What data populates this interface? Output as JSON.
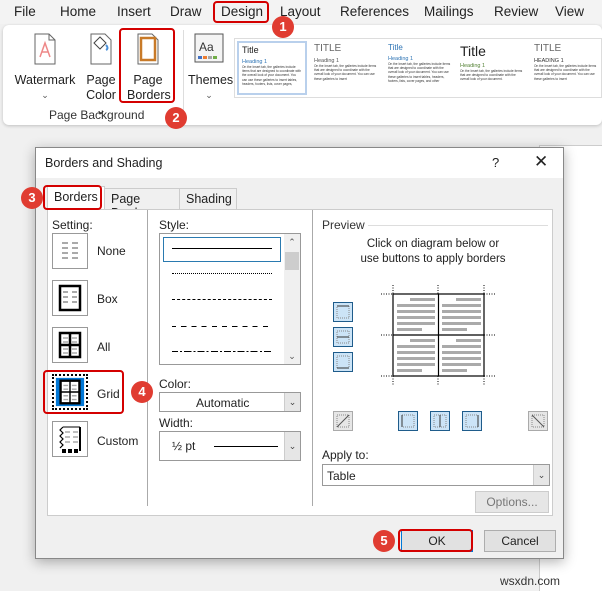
{
  "menu": [
    "File",
    "Home",
    "Insert",
    "Draw",
    "Design",
    "Layout",
    "References",
    "Mailings",
    "Review",
    "View"
  ],
  "ribbon": {
    "watermark": {
      "label1": "Watermark",
      "chev": "⌄"
    },
    "page_color": {
      "label1": "Page",
      "label2": "Color ⌄"
    },
    "page_borders": {
      "label1": "Page",
      "label2": "Borders"
    },
    "themes": {
      "label1": "Themes",
      "chev": "⌄"
    },
    "group_name": "Page Background",
    "gallery": [
      {
        "title": "Title",
        "heading": "Heading 1",
        "body": "On the Insert tab, the galleries include items that are designed to coordinate with the overall look of your document. You can use these galleries to insert tables, headers, footers, lists, cover pages,"
      },
      {
        "title": "TITLE",
        "heading": "Heading 1",
        "body": "On the Insert tab, the galleries include items that are designed to coordinate with the overall look of your document. You can use these galleries to insert"
      },
      {
        "title": "Title",
        "heading": "Heading 1",
        "body": "On the Insert tab, the galleries include items that are designed to coordinate with the overall look of your document. You can use these galleries to insert tables, headers, footers, lists, cover pages, and other"
      },
      {
        "title": "Title",
        "heading": "Heading 1",
        "body": "On the Insert tab, the galleries include items that are designed to coordinate with the overall look of your document."
      },
      {
        "title": "TITLE",
        "heading": "HEADING 1",
        "body": "On the Insert tab, the galleries include items that are designed to coordinate with the overall look of your document. You can use these galleries to insert"
      }
    ]
  },
  "badges": [
    "1",
    "2",
    "3",
    "4",
    "5"
  ],
  "dialog": {
    "title": "Borders and Shading",
    "help": "?",
    "close": "✕",
    "tabs": [
      "Borders",
      "Page Border",
      "Shading"
    ],
    "setting_label": "Setting:",
    "settings": [
      "None",
      "Box",
      "All",
      "Grid",
      "Custom"
    ],
    "selected_setting": "Grid",
    "style_label": "Style:",
    "color_label": "Color:",
    "color_value": "Automatic",
    "width_label": "Width:",
    "width_value": "½ pt",
    "preview_label": "Preview",
    "preview_hint1": "Click on diagram below or",
    "preview_hint2": "use buttons to apply borders",
    "apply_label": "Apply to:",
    "apply_value": "Table",
    "options_label": "Options...",
    "ok_label": "OK",
    "cancel_label": "Cancel"
  },
  "watermark_text": "wsxdn.com",
  "colors": {
    "highlight": "#d40000",
    "badge": "#e03c31",
    "selected_blue": "#cce4f7"
  }
}
